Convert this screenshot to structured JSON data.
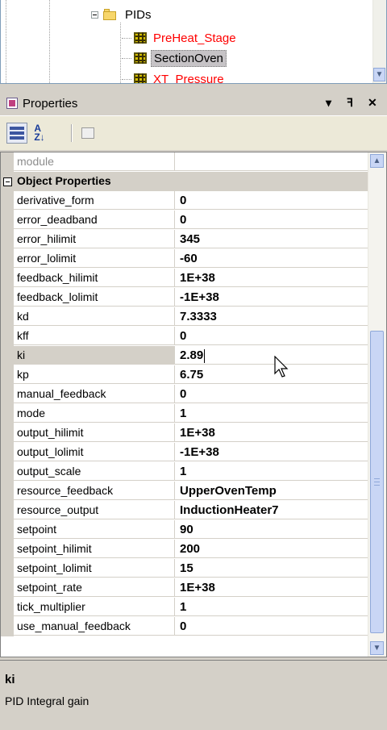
{
  "tree": {
    "folder_label": "PIDs",
    "nodes": [
      {
        "label": "PreHeat_Stage",
        "state": "error"
      },
      {
        "label": "SectionOven",
        "state": "selected"
      },
      {
        "label": "XT_Pressure",
        "state": "error"
      }
    ],
    "icons": {
      "expander": "collapse-minus-icon",
      "folder": "folder-icon",
      "node": "pid-block-icon"
    }
  },
  "panel": {
    "title": "Properties",
    "buttons": {
      "menu": "▾",
      "pin": "ꟻ",
      "close": "✕"
    },
    "icon": "properties-window-icon"
  },
  "toolbar": {
    "categorized_icon": "categorized-icon",
    "alphabetical_label": "A\nZ↓",
    "property_pages_icon": "property-pages-icon"
  },
  "grid": {
    "partial_row": {
      "name": "module",
      "value": ""
    },
    "category": "Object Properties",
    "rows": [
      {
        "name": "derivative_form",
        "value": "0"
      },
      {
        "name": "error_deadband",
        "value": "0"
      },
      {
        "name": "error_hilimit",
        "value": "345"
      },
      {
        "name": "error_lolimit",
        "value": "-60"
      },
      {
        "name": "feedback_hilimit",
        "value": "1E+38"
      },
      {
        "name": "feedback_lolimit",
        "value": "-1E+38"
      },
      {
        "name": "kd",
        "value": "7.3333"
      },
      {
        "name": "kff",
        "value": "0"
      },
      {
        "name": "ki",
        "value": "2.89",
        "selected": true
      },
      {
        "name": "kp",
        "value": "6.75"
      },
      {
        "name": "manual_feedback",
        "value": "0"
      },
      {
        "name": "mode",
        "value": "1"
      },
      {
        "name": "output_hilimit",
        "value": "1E+38"
      },
      {
        "name": "output_lolimit",
        "value": "-1E+38"
      },
      {
        "name": "output_scale",
        "value": "1"
      },
      {
        "name": "resource_feedback",
        "value": "UpperOvenTemp"
      },
      {
        "name": "resource_output",
        "value": "InductionHeater7"
      },
      {
        "name": "setpoint",
        "value": "90"
      },
      {
        "name": "setpoint_hilimit",
        "value": "200"
      },
      {
        "name": "setpoint_lolimit",
        "value": "15"
      },
      {
        "name": "setpoint_rate",
        "value": "1E+38"
      },
      {
        "name": "tick_multiplier",
        "value": "1"
      },
      {
        "name": "use_manual_feedback",
        "value": "0"
      }
    ]
  },
  "description": {
    "name": "ki",
    "text": "PID Integral gain"
  },
  "colors": {
    "error_text": "#ff0000",
    "panel_bg": "#d4d0c8",
    "scrollbar": "#c9d6f5"
  }
}
